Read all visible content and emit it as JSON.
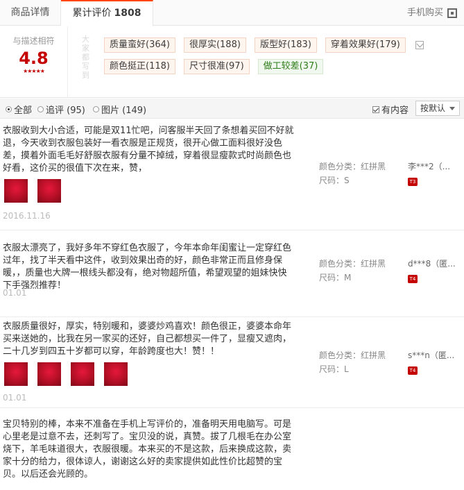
{
  "tabs": {
    "details": "商品详情",
    "reviews": "累计评价",
    "reviews_count": "1808",
    "mobile_buy": "手机购买"
  },
  "summary": {
    "label": "与描述相符",
    "score": "4.8",
    "stars": "★★★★★",
    "tags_title": "大家都写到",
    "tags_row1": [
      "质量蛮好(364)",
      "很厚实(188)",
      "版型好(183)",
      "穿着效果好(179)"
    ],
    "tags_row2": [
      "颜色挺正(118)",
      "尺寸很准(97)"
    ],
    "tag_negative": "做工较差(37)"
  },
  "filter": {
    "all": "全部",
    "append": "追评 (95)",
    "pics": "图片 (149)",
    "has_content": "有内容",
    "sort": "按默认"
  },
  "reviews": [
    {
      "text": "衣服收到大小合适，可能是双11忙吧，问客服半天回了条想着买回不好就退，今天收到衣服包装好一看衣服是正规货，很开心做工面料很好没色差，摸着外面毛毛好舒服衣服有分量不掉绒，穿着很显瘦款式时尚颜色也好看，这价买的很值下次在来，赞，",
      "date": "2016.11.16",
      "color": "颜色分类：红拼黑",
      "size": "尺码：S",
      "user": "李***2（...",
      "level": "T3"
    },
    {
      "text": "衣服太漂亮了，我好多年不穿红色衣服了，今年本命年闺蜜让一定穿红色过年，找了半天看中这件，收到效果出奇的好，颜色非常正而且修身保暖，，质量也大牌一根线头都没有，绝对物超所值，希望观望的姐妹快快下手强烈推荐！",
      "date": "01.01",
      "color": "颜色分类：红拼黑",
      "size": "尺码：M",
      "user": "d***8（匿...",
      "level": "T4"
    },
    {
      "text": "衣服质量很好，厚实，特别暖和，婆婆炒鸡喜欢！颜色很正，婆婆本命年买来送她的，比我在另一家买的还好，自己都想买一件了，显瘦又遮肉，二十几岁到四五十岁都可以穿，年龄跨度也大！赞！！",
      "date": "01.01",
      "color": "颜色分类：红拼黑",
      "size": "尺码：L",
      "user": "s***n（匿...",
      "level": "T4"
    },
    {
      "text": "宝贝特别的棒，本来不准备在手机上写评价的，准备明天用电脑写。可是心里老是过意不去，还刺写了。宝贝没的说，真赞。拔了几根毛在办公室烧下，羊毛味道很大，衣服很暖。本来买的不是这款，后来换成这款，卖家十分的给力，很体谅人，谢谢这么好的卖家提供如此性价比超赞的宝贝。以后还会光顾的。"
    }
  ]
}
